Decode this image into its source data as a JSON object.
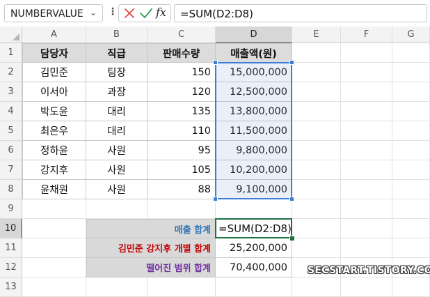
{
  "formula_bar": {
    "name_box": "NUMBERVALUE",
    "formula": "=SUM(D2:D8)"
  },
  "icons": {
    "cancel": "cross-icon",
    "enter": "check-icon",
    "function": "fx",
    "colors": {
      "cancel": "#e04848",
      "enter": "#2e9b4d"
    }
  },
  "columns": [
    "A",
    "B",
    "C",
    "D",
    "E",
    "F",
    "G"
  ],
  "rows": [
    "1",
    "2",
    "3",
    "4",
    "5",
    "6",
    "7",
    "8",
    "9",
    "10",
    "11",
    "12",
    "13"
  ],
  "table": {
    "headers": [
      "담당자",
      "직급",
      "판매수량",
      "매출액(원)"
    ],
    "rows": [
      [
        "김민준",
        "팀장",
        "150",
        "15,000,000"
      ],
      [
        "이서아",
        "과장",
        "120",
        "12,500,000"
      ],
      [
        "박도윤",
        "대리",
        "135",
        "13,800,000"
      ],
      [
        "최은우",
        "대리",
        "110",
        "11,500,000"
      ],
      [
        "정하윤",
        "사원",
        "95",
        "9,800,000"
      ],
      [
        "강지후",
        "사원",
        "105",
        "10,200,000"
      ],
      [
        "윤채원",
        "사원",
        "88",
        "9,100,000"
      ]
    ]
  },
  "summary": [
    {
      "label": "매출 합계",
      "value": "=SUM(D2:D8)",
      "color": "#2e75b6"
    },
    {
      "label": "김민준 강지후 개별 합계",
      "value": "25,200,000",
      "color": "#c00000"
    },
    {
      "label": "떨어진 범위 합계",
      "value": "70,400,000",
      "color": "#7030a0"
    }
  ],
  "selection": {
    "active_cell": "D10",
    "referenced_range": "D2:D8"
  },
  "watermark": "SECSTART.TISTORY.COM"
}
